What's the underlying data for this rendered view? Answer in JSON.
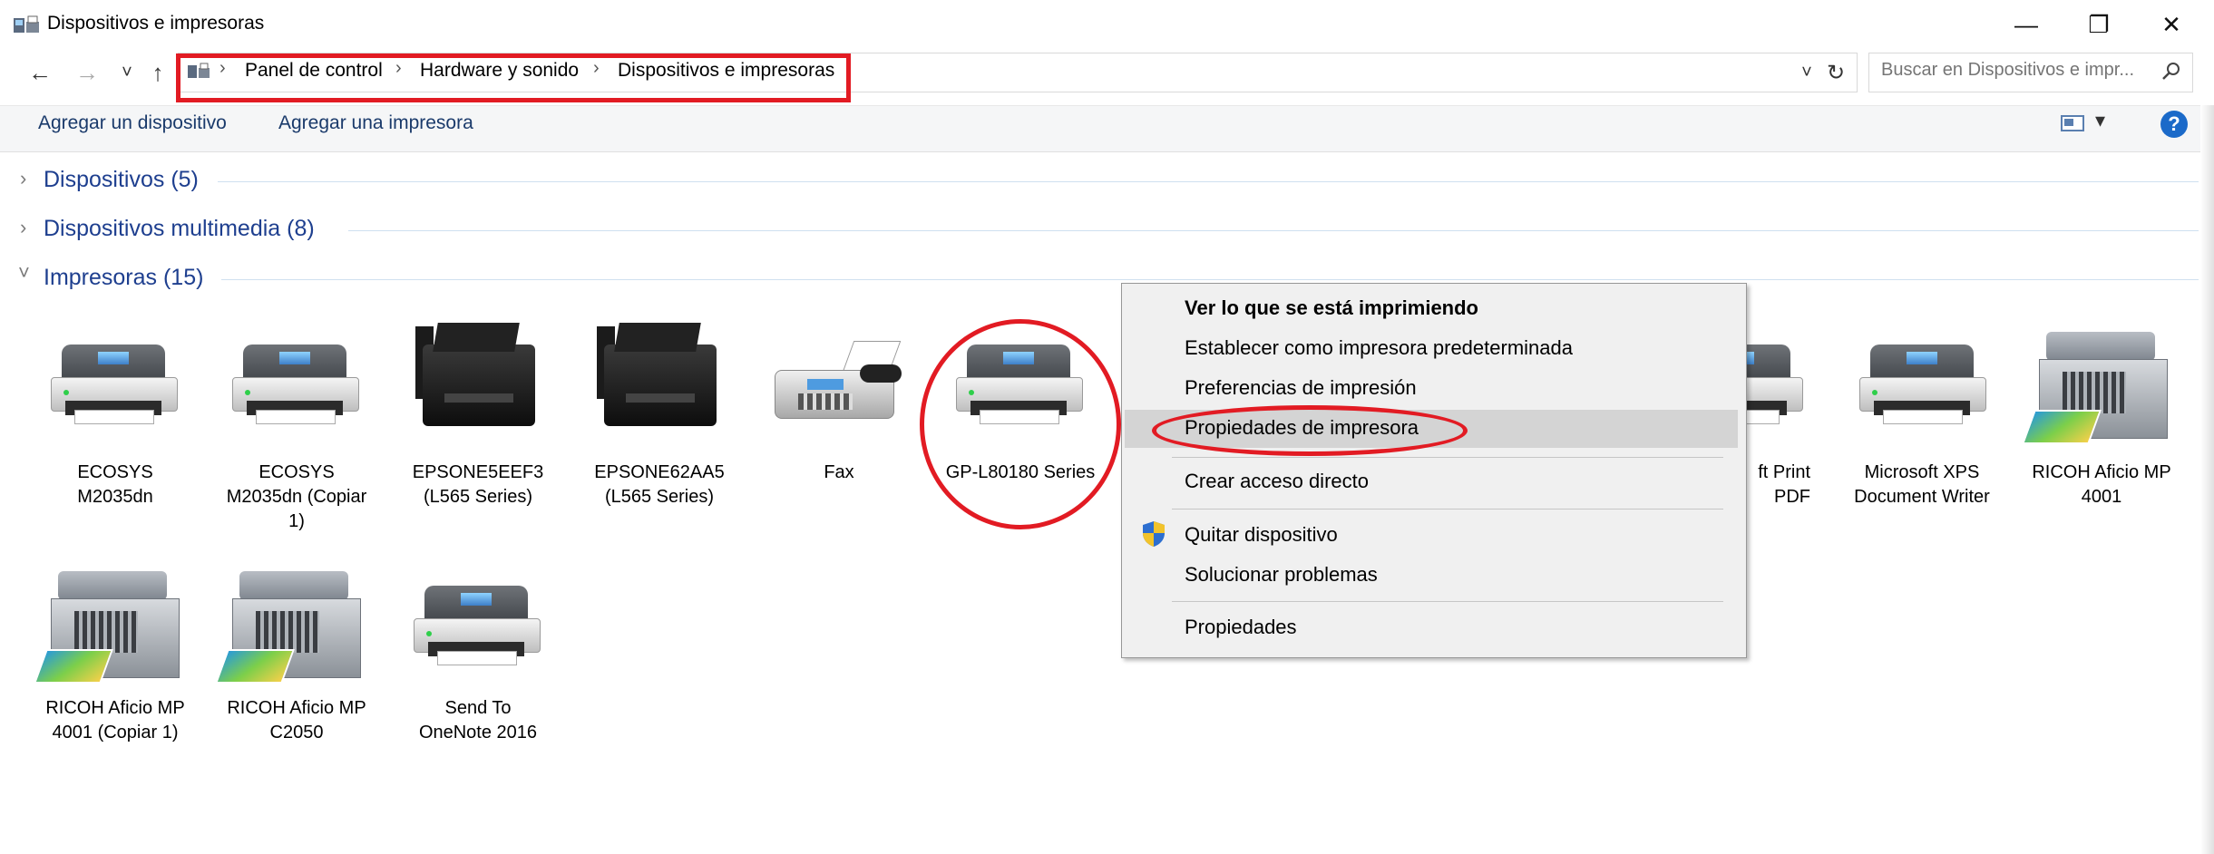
{
  "window": {
    "title": "Dispositivos e impresoras",
    "minimize": "—",
    "maximize": "❐",
    "close": "✕"
  },
  "nav": {
    "back": "←",
    "forward": "→",
    "recent": "˅",
    "up": "↑",
    "dropdown": "˅",
    "refresh": "↻"
  },
  "breadcrumb": {
    "items": [
      "Panel de control",
      "Hardware y sonido",
      "Dispositivos e impresoras"
    ],
    "separator": "›"
  },
  "search": {
    "placeholder": "Buscar en Dispositivos e impr...",
    "icon": "search-icon"
  },
  "toolbar": {
    "add_device": "Agregar un dispositivo",
    "add_printer": "Agregar una impresora",
    "view_dropdown": "▾",
    "help": "?"
  },
  "groups": [
    {
      "label": "Dispositivos (5)",
      "chevron": "›"
    },
    {
      "label": "Dispositivos multimedia (8)",
      "chevron": "›"
    },
    {
      "label": "Impresoras (15)",
      "chevron": "˅"
    }
  ],
  "printers": [
    {
      "line1": "ECOSYS",
      "line2": "M2035dn",
      "line3": "",
      "icon": "printer-icon"
    },
    {
      "line1": "ECOSYS",
      "line2": "M2035dn (Copiar",
      "line3": "1)",
      "icon": "printer-icon"
    },
    {
      "line1": "EPSONE5EEF3",
      "line2": "(L565 Series)",
      "line3": "",
      "icon": "inkjet-printer-icon"
    },
    {
      "line1": "EPSONE62AA5",
      "line2": "(L565 Series)",
      "line3": "",
      "icon": "inkjet-printer-icon"
    },
    {
      "line1": "Fax",
      "line2": "",
      "line3": "",
      "icon": "fax-icon"
    },
    {
      "line1": "GP-L80180 Series",
      "line2": "",
      "line3": "",
      "icon": "printer-icon"
    },
    {
      "line1": "ft Print",
      "line2": "PDF",
      "line3": "",
      "icon": "printer-icon"
    },
    {
      "line1": "Microsoft XPS",
      "line2": "Document Writer",
      "line3": "",
      "icon": "printer-icon"
    },
    {
      "line1": "RICOH Aficio MP",
      "line2": "4001",
      "line3": "",
      "icon": "multifunction-printer-icon"
    },
    {
      "line1": "RICOH Aficio MP",
      "line2": "4001 (Copiar 1)",
      "line3": "",
      "icon": "multifunction-printer-icon"
    },
    {
      "line1": "RICOH Aficio MP",
      "line2": "C2050",
      "line3": "",
      "icon": "multifunction-printer-icon"
    },
    {
      "line1": "Send To",
      "line2": "OneNote 2016",
      "line3": "",
      "icon": "printer-icon"
    }
  ],
  "context_menu": {
    "see_printing": "Ver lo que se está imprimiendo",
    "set_default": "Establecer como impresora predeterminada",
    "preferences": "Preferencias de impresión",
    "printer_properties": "Propiedades de impresora",
    "create_shortcut": "Crear acceso directo",
    "remove_device": "Quitar dispositivo",
    "troubleshoot": "Solucionar problemas",
    "properties": "Propiedades"
  },
  "colors": {
    "annotation_red": "#e21b23",
    "group_blue": "#1e3f8f",
    "help_blue": "#1b6ac9"
  }
}
